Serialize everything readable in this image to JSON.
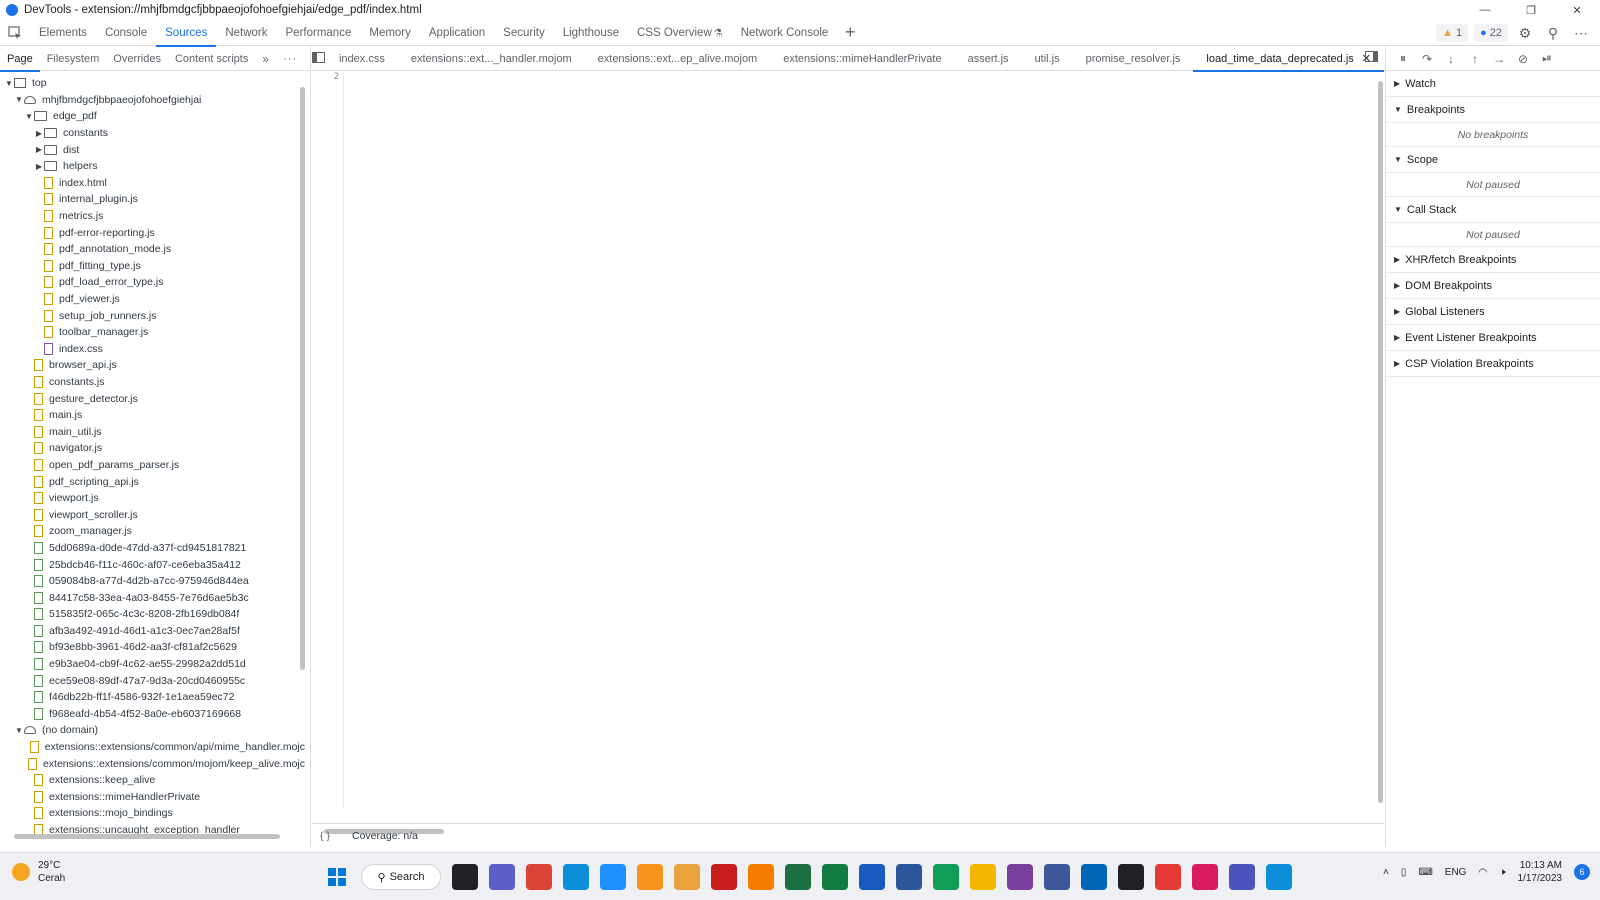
{
  "window": {
    "title": "DevTools - extension://mhjfbmdgcfjbbpaeojofohoefgiehjai/edge_pdf/index.html",
    "controls": [
      "minimize",
      "restore",
      "close"
    ]
  },
  "main_tabs": [
    {
      "label": "Elements"
    },
    {
      "label": "Console"
    },
    {
      "label": "Sources",
      "active": true
    },
    {
      "label": "Network"
    },
    {
      "label": "Performance"
    },
    {
      "label": "Memory"
    },
    {
      "label": "Application"
    },
    {
      "label": "Security"
    },
    {
      "label": "Lighthouse"
    },
    {
      "label": "CSS Overview"
    },
    {
      "label": "Network Console"
    }
  ],
  "toolbar": {
    "warnings": "1",
    "messages": "22"
  },
  "navigator": {
    "tabs": [
      "Page",
      "Filesystem",
      "Overrides",
      "Content scripts"
    ],
    "active_tab": "Page",
    "tree": [
      {
        "depth": 0,
        "type": "frame",
        "label": "top",
        "arrow": "open"
      },
      {
        "depth": 1,
        "type": "cloud",
        "label": "mhjfbmdgcfjbbpaeojofohoefgiehjai",
        "arrow": "open"
      },
      {
        "depth": 2,
        "type": "folder",
        "label": "edge_pdf",
        "arrow": "open"
      },
      {
        "depth": 3,
        "type": "folder",
        "label": "constants",
        "arrow": "closed"
      },
      {
        "depth": 3,
        "type": "folder",
        "label": "dist",
        "arrow": "closed"
      },
      {
        "depth": 3,
        "type": "folder",
        "label": "helpers",
        "arrow": "closed"
      },
      {
        "depth": 3,
        "type": "file-html",
        "label": "index.html"
      },
      {
        "depth": 3,
        "type": "file-js",
        "label": "internal_plugin.js"
      },
      {
        "depth": 3,
        "type": "file-js",
        "label": "metrics.js"
      },
      {
        "depth": 3,
        "type": "file-js",
        "label": "pdf-error-reporting.js"
      },
      {
        "depth": 3,
        "type": "file-js",
        "label": "pdf_annotation_mode.js"
      },
      {
        "depth": 3,
        "type": "file-js",
        "label": "pdf_fitting_type.js"
      },
      {
        "depth": 3,
        "type": "file-js",
        "label": "pdf_load_error_type.js"
      },
      {
        "depth": 3,
        "type": "file-js",
        "label": "pdf_viewer.js"
      },
      {
        "depth": 3,
        "type": "file-js",
        "label": "setup_job_runners.js"
      },
      {
        "depth": 3,
        "type": "file-js",
        "label": "toolbar_manager.js"
      },
      {
        "depth": 3,
        "type": "file-css",
        "label": "index.css"
      },
      {
        "depth": 2,
        "type": "file-js",
        "label": "browser_api.js"
      },
      {
        "depth": 2,
        "type": "file-js",
        "label": "constants.js"
      },
      {
        "depth": 2,
        "type": "file-js",
        "label": "gesture_detector.js"
      },
      {
        "depth": 2,
        "type": "file-js",
        "label": "main.js"
      },
      {
        "depth": 2,
        "type": "file-js",
        "label": "main_util.js"
      },
      {
        "depth": 2,
        "type": "file-js",
        "label": "navigator.js"
      },
      {
        "depth": 2,
        "type": "file-js",
        "label": "open_pdf_params_parser.js"
      },
      {
        "depth": 2,
        "type": "file-js",
        "label": "pdf_scripting_api.js"
      },
      {
        "depth": 2,
        "type": "file-js",
        "label": "viewport.js"
      },
      {
        "depth": 2,
        "type": "file-js",
        "label": "viewport_scroller.js"
      },
      {
        "depth": 2,
        "type": "file-js",
        "label": "zoom_manager.js"
      },
      {
        "depth": 2,
        "type": "file-green",
        "label": "5dd0689a-d0de-47dd-a37f-cd9451817821"
      },
      {
        "depth": 2,
        "type": "file-green",
        "label": "25bdcb46-f11c-460c-af07-ce6eba35a412"
      },
      {
        "depth": 2,
        "type": "file-green",
        "label": "059084b8-a77d-4d2b-a7cc-975946d844ea"
      },
      {
        "depth": 2,
        "type": "file-green",
        "label": "84417c58-33ea-4a03-8455-7e76d6ae5b3c"
      },
      {
        "depth": 2,
        "type": "file-green",
        "label": "515835f2-065c-4c3c-8208-2fb169db084f"
      },
      {
        "depth": 2,
        "type": "file-green",
        "label": "afb3a492-491d-46d1-a1c3-0ec7ae28af5f"
      },
      {
        "depth": 2,
        "type": "file-green",
        "label": "bf93e8bb-3961-46d2-aa3f-cf81af2c5629"
      },
      {
        "depth": 2,
        "type": "file-green",
        "label": "e9b3ae04-cb9f-4c62-ae55-29982a2dd51d"
      },
      {
        "depth": 2,
        "type": "file-green",
        "label": "ece59e08-89df-47a7-9d3a-20cd0460955c"
      },
      {
        "depth": 2,
        "type": "file-green",
        "label": "f46db22b-ff1f-4586-932f-1e1aea59ec72"
      },
      {
        "depth": 2,
        "type": "file-green",
        "label": "f968eafd-4b54-4f52-8a0e-eb6037169668"
      },
      {
        "depth": 1,
        "type": "cloud",
        "label": "(no domain)",
        "arrow": "open"
      },
      {
        "depth": 2,
        "type": "file-js",
        "label": "extensions::extensions/common/api/mime_handler.mojc"
      },
      {
        "depth": 2,
        "type": "file-js",
        "label": "extensions::extensions/common/mojom/keep_alive.mojc"
      },
      {
        "depth": 2,
        "type": "file-js",
        "label": "extensions::keep_alive"
      },
      {
        "depth": 2,
        "type": "file-js",
        "label": "extensions::mimeHandlerPrivate"
      },
      {
        "depth": 2,
        "type": "file-js",
        "label": "extensions::mojo_bindings"
      },
      {
        "depth": 2,
        "type": "file-js",
        "label": "extensions::uncaught_exception_handler"
      }
    ]
  },
  "editor": {
    "tabs": [
      {
        "label": "index.css"
      },
      {
        "label": "extensions::ext..._handler.mojom"
      },
      {
        "label": "extensions::ext...ep_alive.mojom"
      },
      {
        "label": "extensions::mimeHandlerPrivate"
      },
      {
        "label": "assert.js"
      },
      {
        "label": "util.js"
      },
      {
        "label": "promise_resolver.js"
      },
      {
        "label": "load_time_data_deprecated.js",
        "active": true,
        "closable": true
      }
    ],
    "line_number": "2",
    "status": {
      "brace": "{ }",
      "coverage": "Coverage: n/a"
    }
  },
  "debugger": {
    "sections": [
      {
        "label": "Watch",
        "open": false
      },
      {
        "label": "Breakpoints",
        "open": true,
        "body": "No breakpoints"
      },
      {
        "label": "Scope",
        "open": true,
        "body": "Not paused"
      },
      {
        "label": "Call Stack",
        "open": true,
        "body": "Not paused"
      },
      {
        "label": "XHR/fetch Breakpoints",
        "open": false
      },
      {
        "label": "DOM Breakpoints",
        "open": false
      },
      {
        "label": "Global Listeners",
        "open": false
      },
      {
        "label": "Event Listener Breakpoints",
        "open": false
      },
      {
        "label": "CSP Violation Breakpoints",
        "open": false
      }
    ]
  },
  "taskbar": {
    "weather_temp": "29°C",
    "weather_desc": "Cerah",
    "search_label": "Search",
    "language": "ENG",
    "time": "10:13 AM",
    "date": "1/17/2023",
    "notification_count": "6",
    "apps": [
      {
        "icon": "start-icon",
        "color": "#0078d4"
      },
      {
        "icon": "task-view-icon",
        "color": "#202124"
      },
      {
        "icon": "chat-icon",
        "color": "#5b5fc7"
      },
      {
        "icon": "chrome-icon",
        "color": "#db4437"
      },
      {
        "icon": "edge-icon",
        "color": "#0c8ed9"
      },
      {
        "icon": "ie-icon",
        "color": "#1e90ff"
      },
      {
        "icon": "bitcoin-icon",
        "color": "#f7931a"
      },
      {
        "icon": "chrome-canary-icon",
        "color": "#e8a33d"
      },
      {
        "icon": "r-app-icon",
        "color": "#c81e1e"
      },
      {
        "icon": "blogger-icon",
        "color": "#f57d00"
      },
      {
        "icon": "excel-tool-icon",
        "color": "#1d6f42"
      },
      {
        "icon": "excel-icon",
        "color": "#107c41"
      },
      {
        "icon": "word-icon",
        "color": "#185abd"
      },
      {
        "icon": "word-doc-icon",
        "color": "#2b579a"
      },
      {
        "icon": "photos-icon",
        "color": "#0f9d58"
      },
      {
        "icon": "explorer-icon",
        "color": "#f2b600"
      },
      {
        "icon": "person-app-icon",
        "color": "#7a3e9d"
      },
      {
        "icon": "person-app2-icon",
        "color": "#3b5998"
      },
      {
        "icon": "store-icon",
        "color": "#0067b8"
      },
      {
        "icon": "wikipedia-icon",
        "color": "#202124"
      },
      {
        "icon": "maps-icon",
        "color": "#e53935"
      },
      {
        "icon": "calendar-app-icon",
        "color": "#d81b60"
      },
      {
        "icon": "teams-icon",
        "color": "#4b53bc"
      },
      {
        "icon": "edge-dev-icon",
        "color": "#0c8ed9"
      }
    ]
  }
}
